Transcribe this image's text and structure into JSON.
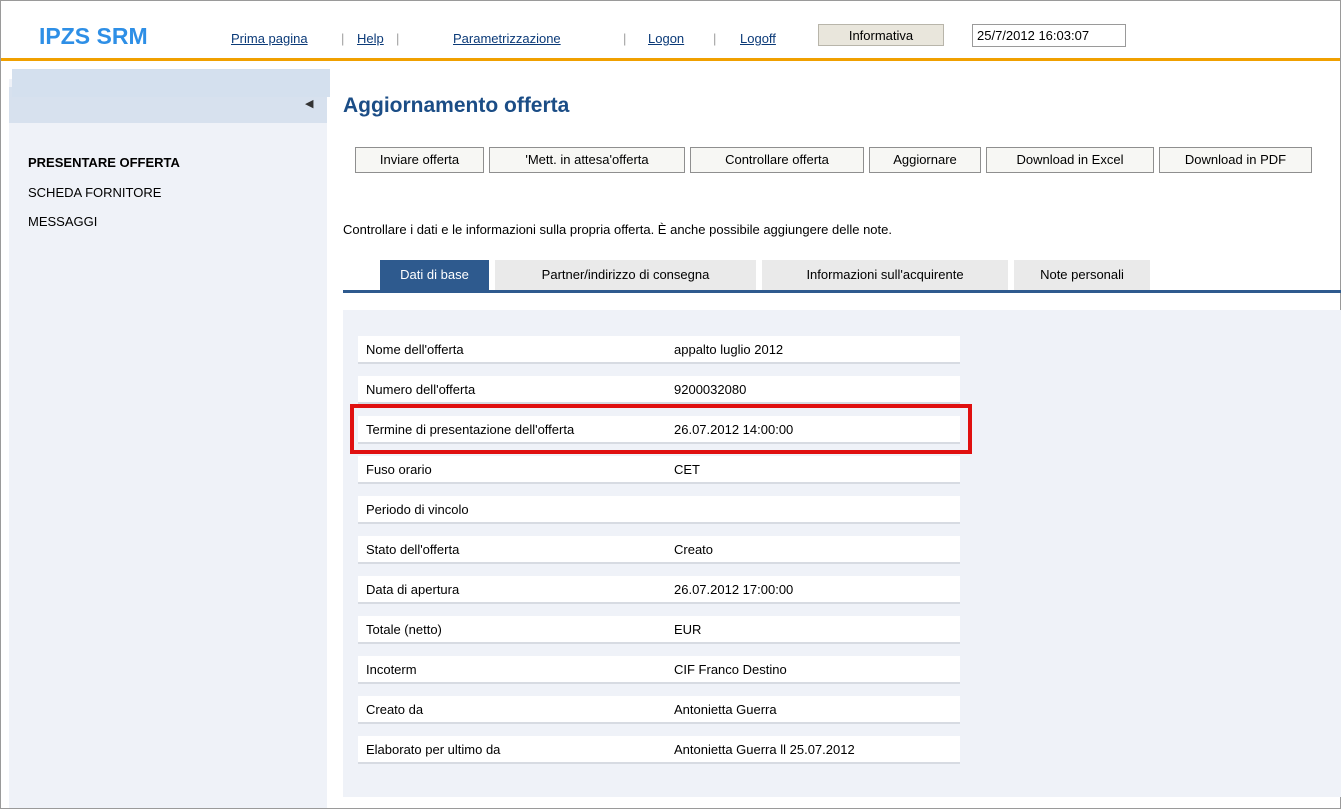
{
  "header": {
    "logo": "IPZS SRM",
    "nav": [
      "Prima pagina",
      "Help",
      "Parametrizzazione",
      "Logon",
      "Logoff"
    ],
    "info_button": "Informativa",
    "datetime": "25/7/2012 16:03:07"
  },
  "sidebar": {
    "items": [
      "PRESENTARE OFFERTA",
      "SCHEDA FORNITORE",
      "MESSAGGI"
    ]
  },
  "page": {
    "title": "Aggiornamento offerta",
    "buttons": [
      "Inviare offerta",
      "'Mett. in attesa'offerta",
      "Controllare offerta",
      "Aggiornare",
      "Download in Excel",
      "Download in PDF"
    ],
    "description": "Controllare i dati e le informazioni sulla propria offerta. È anche possibile aggiungere delle note.",
    "tabs": [
      "Dati di base",
      "Partner/indirizzo di consegna",
      "Informazioni sull'acquirente",
      "Note personali"
    ]
  },
  "details": [
    {
      "label": "Nome dell'offerta",
      "value": "appalto luglio 2012"
    },
    {
      "label": "Numero dell'offerta",
      "value": "9200032080"
    },
    {
      "label": "Termine di presentazione dell'offerta",
      "value": "26.07.2012   14:00:00"
    },
    {
      "label": "Fuso orario",
      "value": "CET"
    },
    {
      "label": "Periodo di vincolo",
      "value": ""
    },
    {
      "label": "Stato dell'offerta",
      "value": "Creato"
    },
    {
      "label": "Data di apertura",
      "value": "26.07.2012 17:00:00"
    },
    {
      "label": "Totale (netto)",
      "value": " EUR"
    },
    {
      "label": "Incoterm",
      "value": " CIF Franco Destino"
    },
    {
      "label": "Creato da",
      "value": "Antonietta   Guerra"
    },
    {
      "label": "Elaborato per ultimo da",
      "value": "Antonietta   Guerra ll   25.07.2012"
    }
  ],
  "colors": {
    "brand": "#2e8fe6",
    "accent": "#f0a000",
    "tab_active": "#2e5a8e",
    "highlight": "#e01010"
  },
  "icons": {
    "collapse": "triangle-left-icon"
  }
}
